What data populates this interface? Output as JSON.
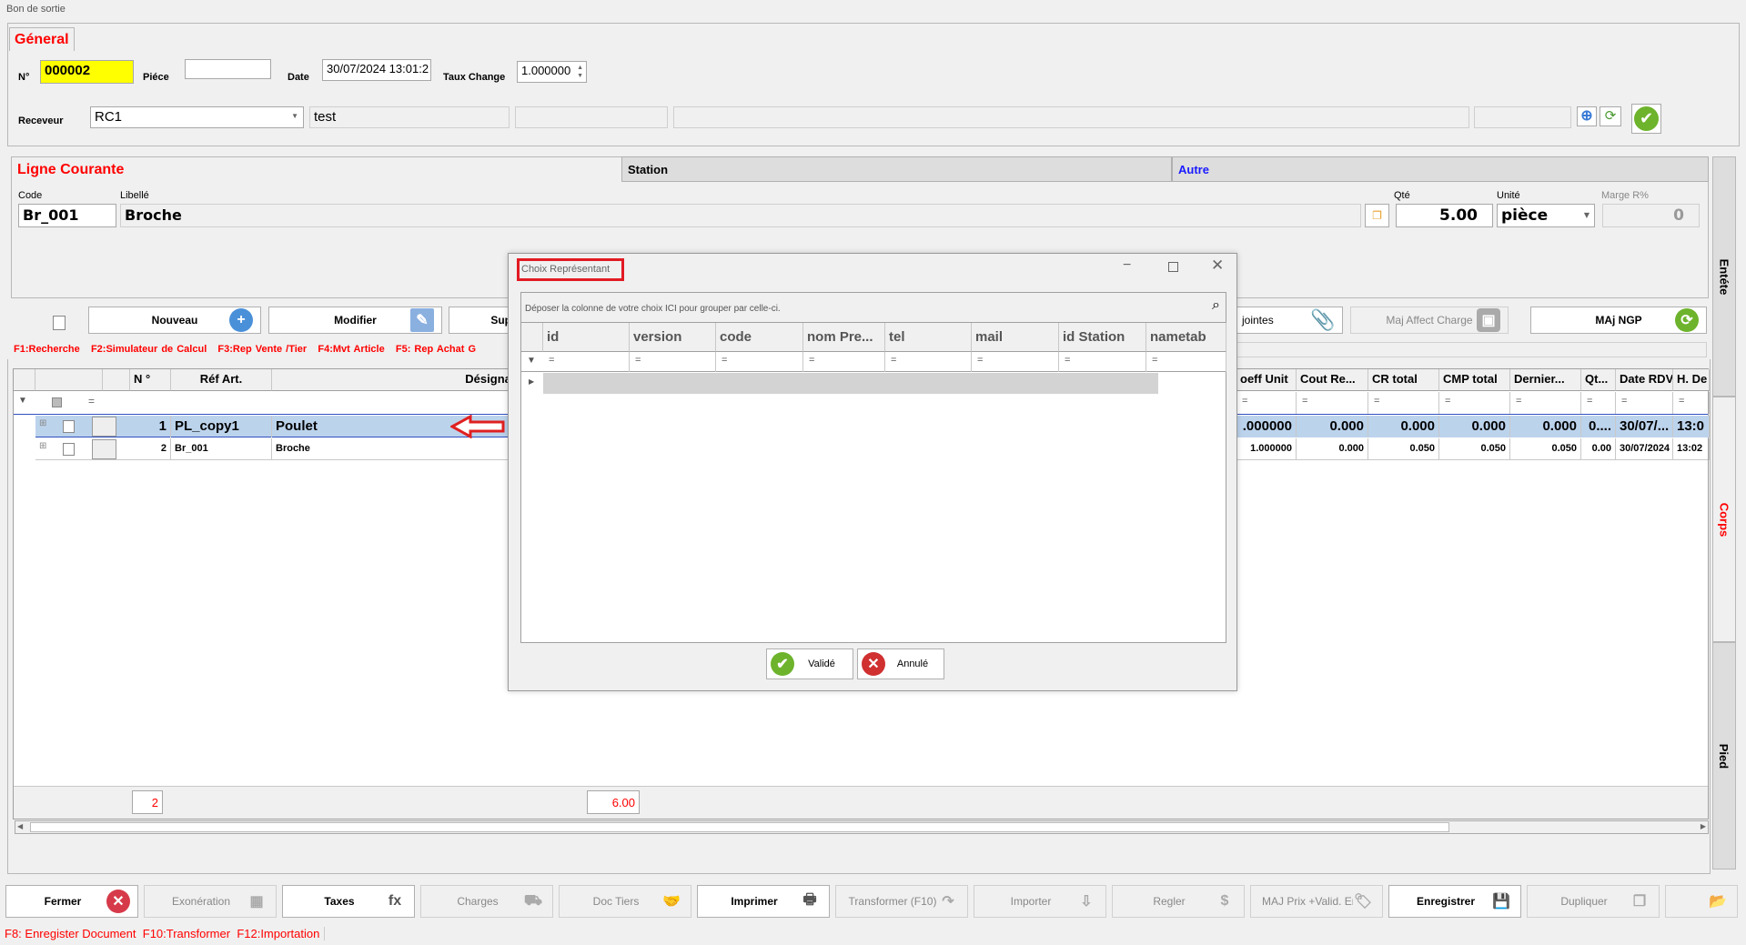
{
  "window": {
    "title": "Bon de sortie"
  },
  "general": {
    "tab": "Géneral",
    "no_label": "N°",
    "no_value": "000002",
    "piece_label": "Piéce",
    "piece_value": "",
    "date_label": "Date",
    "date_value": "30/07/2024 13:01:2",
    "taux_label": "Taux Change",
    "taux_value": "1.000000",
    "receveur_label": "Receveur",
    "receveur_value": "RC1",
    "receveur_name": "test"
  },
  "ligne": {
    "title": "Ligne Courante",
    "tab_station": "Station",
    "tab_autre": "Autre",
    "code_label": "Code",
    "code_value": "Br_001",
    "libelle_label": "Libellé",
    "libelle_value": "Broche",
    "qte_label": "Qté",
    "qte_value": "5.00",
    "unite_label": "Unité",
    "unite_value": "pièce",
    "marge_label": "Marge R%",
    "marge_value": "0"
  },
  "side_tabs": [
    "Entéte",
    "Corps",
    "Pied"
  ],
  "actions": {
    "nouveau": "Nouveau",
    "modifier": "Modifier",
    "supprimer": "Sup",
    "jointes": "jointes",
    "maj_affect": "Maj Affect Charge",
    "maj_ngp": "MAj NGP"
  },
  "hints": [
    "F1:Recherche",
    "F2:Simulateur de Calcul",
    "F3:Rep Vente /Tier",
    "F4:Mvt Article",
    "F5: Rep Achat G"
  ],
  "grid": {
    "headers_left": [
      "N °",
      "Réf Art.",
      "Désignation"
    ],
    "headers_right": [
      "oeff Unit",
      "Cout Re...",
      "CR total",
      "CMP total",
      "Dernier...",
      "Qt...",
      "Date RDV",
      "H. De"
    ],
    "rows": [
      {
        "n": "1",
        "ref": "PL_copy1",
        "des": "Poulet",
        "right": [
          ".000000",
          "0.000",
          "0.000",
          "0.000",
          "0.000",
          "0....",
          "30/07/...",
          "13:0"
        ]
      },
      {
        "n": "2",
        "ref": "Br_001",
        "des": "Broche",
        "right": [
          "1.000000",
          "0.000",
          "0.050",
          "0.050",
          "0.050",
          "0.00",
          "30/07/2024",
          "13:02"
        ]
      }
    ],
    "total_count": "2",
    "total_qty": "6.00"
  },
  "dialog": {
    "title": "Choix Représentant",
    "group_hint": "Déposer la colonne de votre choix ICI pour grouper par celle-ci.",
    "columns": [
      "id",
      "version",
      "code",
      "nom Pre...",
      "tel",
      "mail",
      "id Station",
      "nametab"
    ],
    "ok": "Validé",
    "cancel": "Annulé"
  },
  "toolbar": [
    "Fermer",
    "Exonération",
    "Taxes",
    "Charges",
    "Doc Tiers",
    "Imprimer",
    "Transformer (F10)",
    "Importer",
    "Regler",
    "MAJ Prix +Valid. Ent",
    "Enregistrer",
    "Dupliquer",
    ""
  ],
  "footer_hints": [
    "F8: Enregister Document",
    "F10:Transformer",
    "F12:Importation"
  ],
  "colors": {
    "accent": "#ff0000",
    "selected_row": "#bcd3ec",
    "yellow": "#ffff00"
  }
}
